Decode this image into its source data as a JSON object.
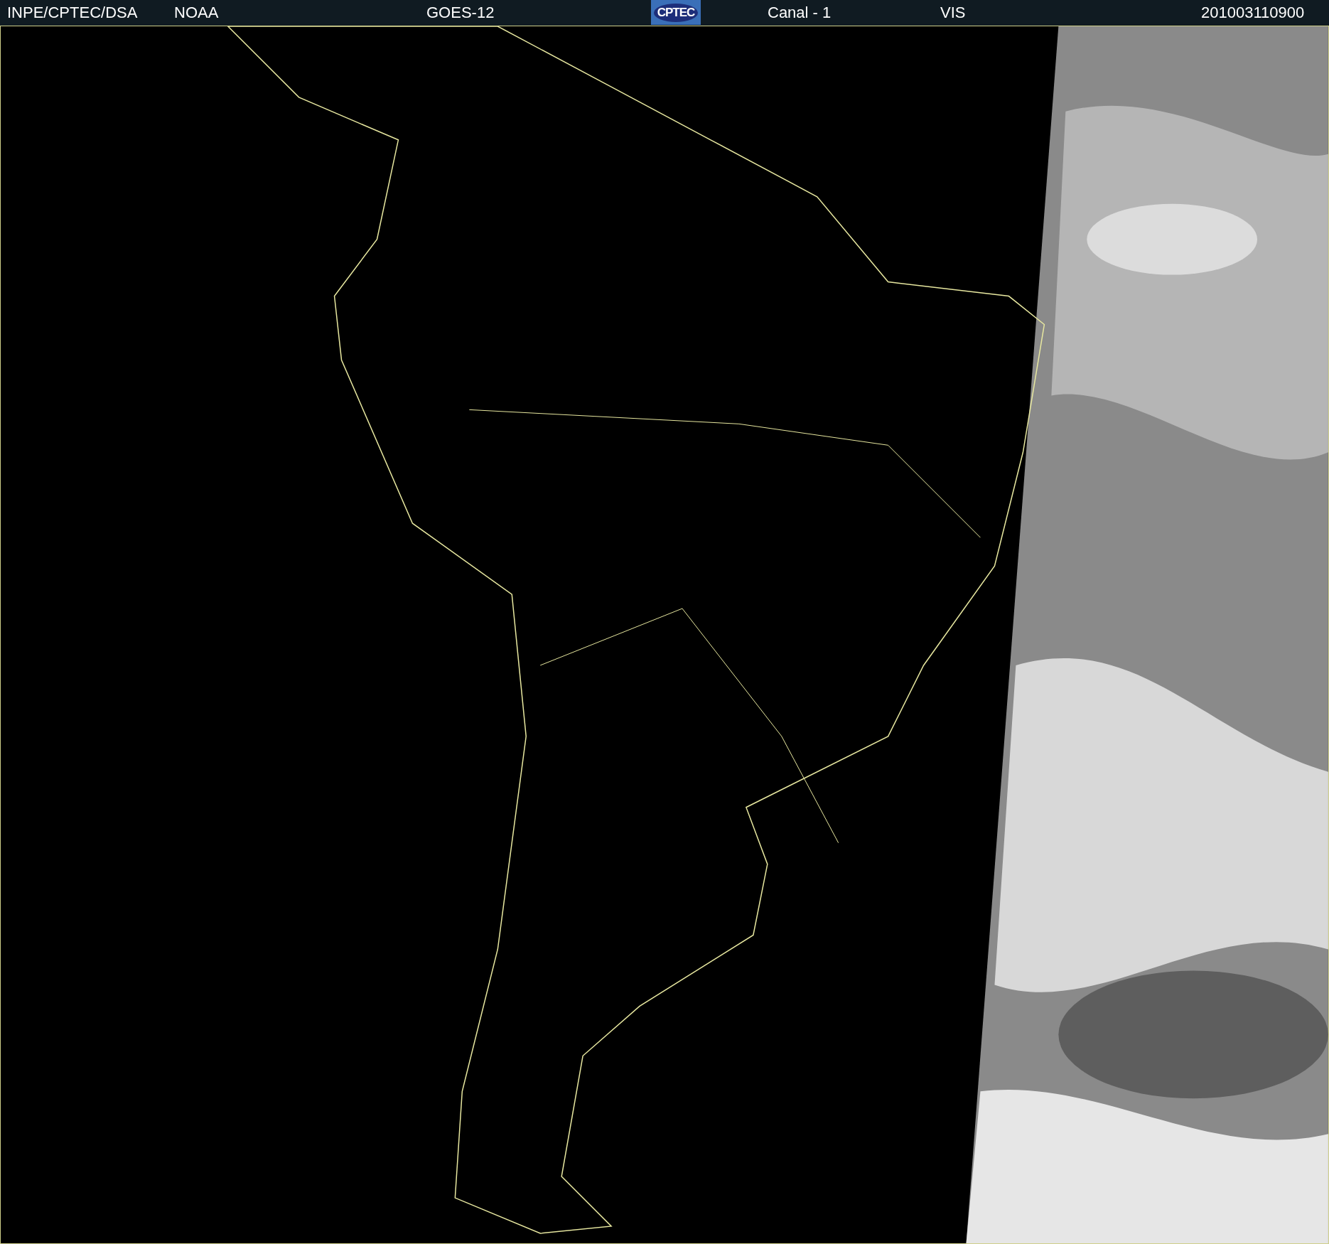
{
  "header": {
    "items": [
      {
        "kind": "text",
        "label": "INPE/CPTEC/DSA"
      },
      {
        "kind": "text",
        "label": "NOAA"
      },
      {
        "kind": "text",
        "label": "GOES-12"
      },
      {
        "kind": "logo",
        "label": "CPTEC"
      },
      {
        "kind": "text",
        "label": "Canal - 1"
      },
      {
        "kind": "text",
        "label": "VIS"
      },
      {
        "kind": "text",
        "label": "201003110900"
      }
    ]
  }
}
